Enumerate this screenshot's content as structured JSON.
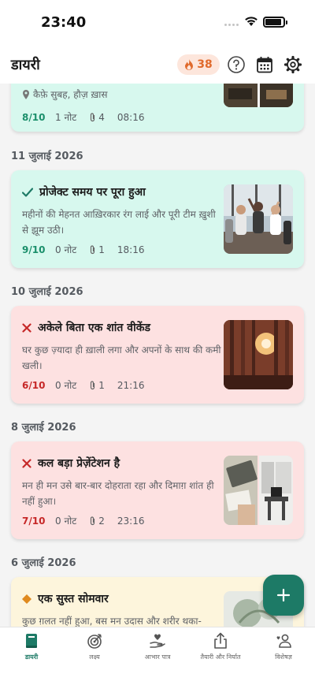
{
  "status_bar": {
    "time": "23:40"
  },
  "header": {
    "title": "डायरी",
    "streak_count": "38"
  },
  "entries": [
    {
      "location": "कैफ़े सुबह, हौज़ ख़ास",
      "score": "8/10",
      "notes": "1 नोट",
      "attachments": "4",
      "time": "08:16",
      "mood": "positive"
    },
    {
      "date": "11 जुलाई 2026",
      "title": "प्रोजेक्ट समय पर पूरा हुआ",
      "body": "महीनों की मेहनत आख़िरकार रंग लाई और पूरी टीम ख़ुशी से झूम उठी।",
      "score": "9/10",
      "notes": "0 नोट",
      "attachments": "1",
      "time": "18:16",
      "mood": "positive"
    },
    {
      "date": "10 जुलाई 2026",
      "title": "अकेले बिता एक शांत वीकेंड",
      "body": "घर कुछ ज़्यादा ही ख़ाली लगा और अपनों के साथ की कमी खली।",
      "score": "6/10",
      "notes": "0 नोट",
      "attachments": "1",
      "time": "21:16",
      "mood": "negative"
    },
    {
      "date": "8 जुलाई 2026",
      "title": "कल बड़ा प्रेज़ेंटेशन है",
      "body": "मन ही मन उसे बार-बार दोहराता रहा और दिमाग़ शांत ही नहीं हुआ।",
      "score": "7/10",
      "notes": "0 नोट",
      "attachments": "2",
      "time": "23:16",
      "mood": "negative"
    },
    {
      "date": "6 जुलाई 2026",
      "title": "एक सुस्त सोमवार",
      "body": "कुछ ग़लत नहीं हुआ, बस मन उदास और शरीर थका-",
      "mood": "neutral"
    }
  ],
  "nav": {
    "items": [
      {
        "label": "डायरी",
        "icon": "book-icon",
        "active": true
      },
      {
        "label": "लक्ष्य",
        "icon": "target-icon",
        "active": false
      },
      {
        "label": "आभार पात्र",
        "icon": "heart-hand-icon",
        "active": false
      },
      {
        "label": "तैयारी और निर्यात",
        "icon": "share-icon",
        "active": false
      },
      {
        "label": "विशेषज्ञ",
        "icon": "expert-icon",
        "active": false
      }
    ]
  },
  "colors": {
    "accent": "#1d7a66",
    "positive_card": "#d7f8ee",
    "negative_card": "#fde1e1",
    "neutral_card": "#fdf5dc",
    "streak": "#e06a2c"
  }
}
